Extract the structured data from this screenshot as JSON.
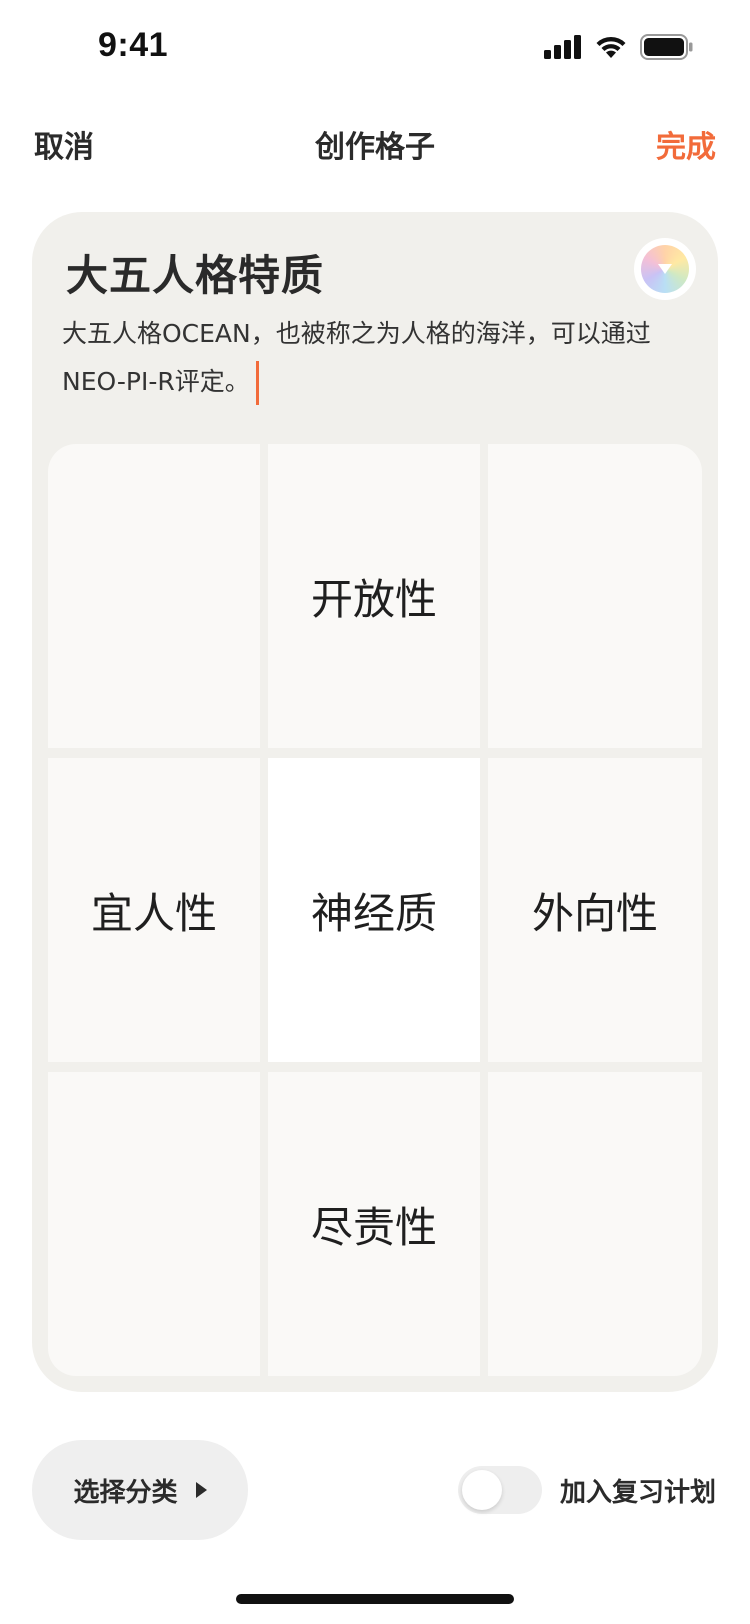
{
  "status_bar": {
    "time": "9:41",
    "icons": [
      "cellular-signal-icon",
      "wifi-icon",
      "battery-icon"
    ]
  },
  "nav": {
    "cancel_label": "取消",
    "title": "创作格子",
    "done_label": "完成",
    "accent_color": "#f26b3a"
  },
  "card": {
    "title": "大五人格特质",
    "description": "大五人格OCEAN，也被称之为人格的海洋，可以通过NEO-PI-R评定。",
    "color_picker_icon": "color-wheel-icon",
    "background_color": "#f1f0ec"
  },
  "grid": {
    "cells": [
      "",
      "开放性",
      "",
      "宜人性",
      "神经质",
      "外向性",
      "",
      "尽责性",
      ""
    ]
  },
  "bottom": {
    "category_label": "选择分类",
    "category_icon": "triangle-right-icon",
    "review_label": "加入复习计划",
    "review_enabled": false
  }
}
